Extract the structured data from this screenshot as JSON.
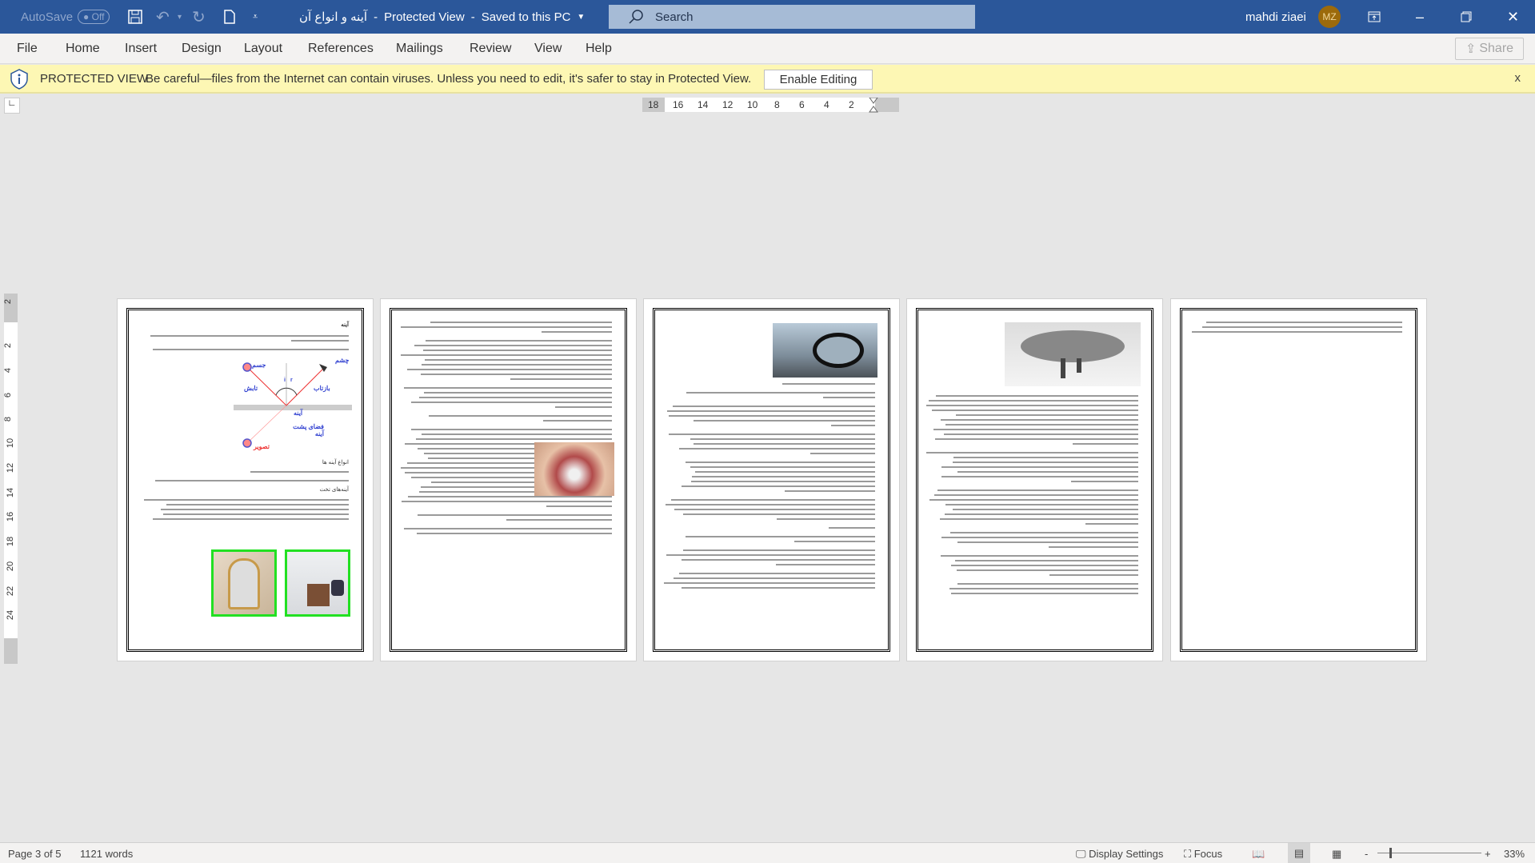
{
  "titlebar": {
    "autosave_label": "AutoSave",
    "autosave_state": "Off",
    "doc_title": "آینه و انواع آن",
    "sep1": "-",
    "view_mode": "Protected View",
    "sep2": "-",
    "save_status": "Saved to this PC",
    "search_placeholder": "Search",
    "user_name": "mahdi ziaei",
    "user_initials": "MZ",
    "colors": {
      "bar": "#2b579a",
      "avatar": "#9c6a0b"
    }
  },
  "menu": {
    "tabs": [
      "File",
      "Home",
      "Insert",
      "Design",
      "Layout",
      "References",
      "Mailings",
      "Review",
      "View",
      "Help"
    ],
    "share_label": "Share"
  },
  "protected_view": {
    "title": "PROTECTED VIEW",
    "message": "Be careful—files from the Internet can contain viruses. Unless you need to edit, it's safer to stay in Protected View.",
    "enable_button": "Enable Editing",
    "close": "x",
    "color": "#fdf7b4"
  },
  "ruler": {
    "horizontal": [
      "18",
      "16",
      "14",
      "12",
      "10",
      "8",
      "6",
      "4",
      "2"
    ],
    "vertical": [
      "2",
      "2",
      "4",
      "6",
      "8",
      "10",
      "12",
      "14",
      "16",
      "18",
      "20",
      "22",
      "24"
    ]
  },
  "document": {
    "page1": {
      "heading": "آینه",
      "diagram": {
        "object": "جسم",
        "eye": "چشم",
        "incident": "تابش",
        "reflected": "بازتاب",
        "mirror": "آینه",
        "behind_mirror": "فضای پشت آینه",
        "image": "تصویر",
        "angle_i": "i",
        "angle_r": "r"
      },
      "section1": "انواع آینه ها",
      "section2": "آینه‌های تخت"
    }
  },
  "status": {
    "page": "Page 3 of 5",
    "words": "1121 words",
    "display_settings": "Display Settings",
    "focus": "Focus",
    "zoom_minus": "-",
    "zoom_plus": "+",
    "zoom": "33%"
  }
}
